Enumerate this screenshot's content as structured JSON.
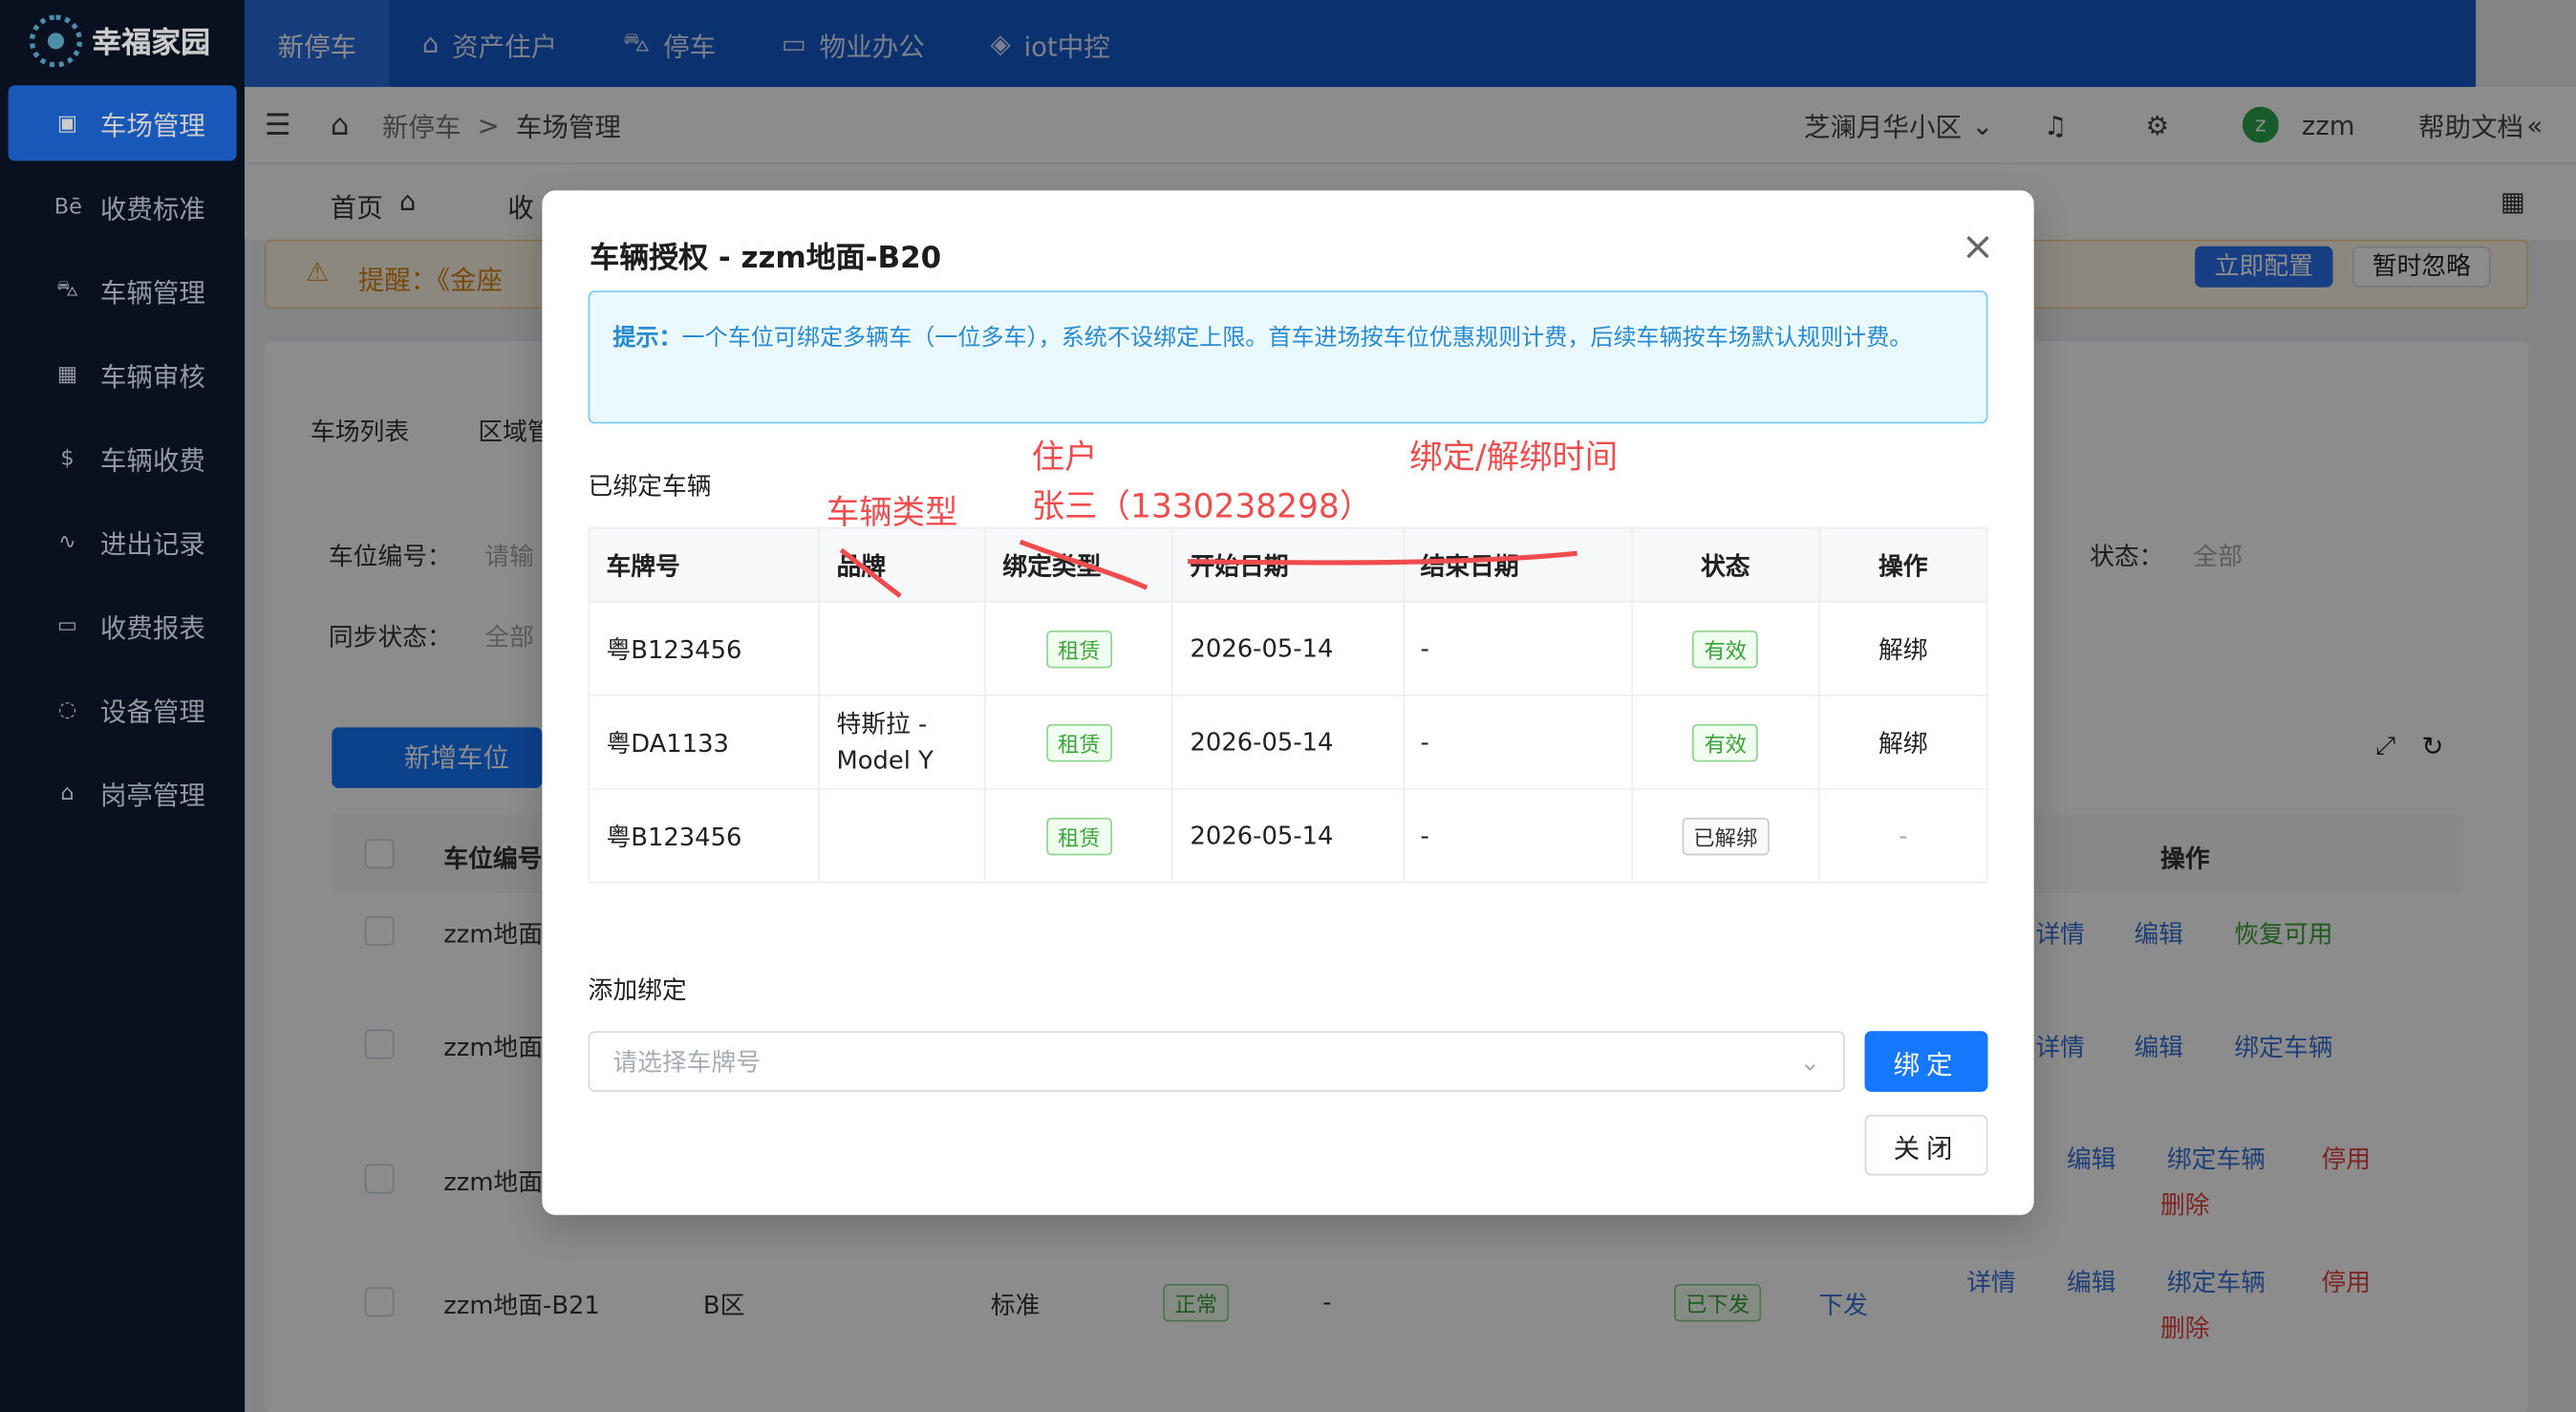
{
  "app": {
    "brand": "幸福家园"
  },
  "sidebar": {
    "items": [
      {
        "icon": "chip-icon",
        "label": "车场管理",
        "active": true
      },
      {
        "icon": "be-icon",
        "label": "收费标准"
      },
      {
        "icon": "car-icon",
        "label": "车辆管理"
      },
      {
        "icon": "building-icon",
        "label": "车辆审核"
      },
      {
        "icon": "coin-icon",
        "label": "车辆收费"
      },
      {
        "icon": "route-icon",
        "label": "进出记录"
      },
      {
        "icon": "monitor-icon",
        "label": "收费报表"
      },
      {
        "icon": "device-icon",
        "label": "设备管理"
      },
      {
        "icon": "bank-icon",
        "label": "岗亭管理"
      }
    ]
  },
  "topnav": {
    "tabs": [
      {
        "label": "新停车",
        "active": true
      },
      {
        "label": "资产住户",
        "icon": "home-icon"
      },
      {
        "label": "停车",
        "icon": "car-icon"
      },
      {
        "label": "物业办公",
        "icon": "laptop-icon"
      },
      {
        "label": "iot中控",
        "icon": "cube-icon"
      }
    ]
  },
  "header": {
    "breadcrumb": [
      "新停车",
      ">",
      "车场管理"
    ],
    "community": "芝澜月华小区",
    "user": "zzm",
    "user_initial": "z",
    "help": "帮助文档"
  },
  "page_tabs": {
    "home": "首页",
    "second": "收"
  },
  "background": {
    "reminder": "提醒：《金座",
    "config_button": "立即配置",
    "ignore_button": "暂时忽略",
    "tabs": [
      "车场列表",
      "区域管"
    ],
    "filters": {
      "space_no": "车位编号：",
      "space_placeholder": "请输",
      "sync": "同步状态：",
      "sync_value": "全部",
      "status": "状态：",
      "status_value": "全部"
    },
    "add_button": "新增车位",
    "table_header": {
      "space": "车位编号",
      "action": "操作"
    },
    "rows": [
      {
        "space": "zzm地面",
        "actions": [
          "详情",
          "编辑",
          "恢复可用"
        ]
      },
      {
        "space": "zzm地面",
        "actions": [
          "详情",
          "编辑",
          "绑定车辆"
        ]
      },
      {
        "space": "zzm地面",
        "actions": [
          "编辑",
          "绑定车辆",
          "停用",
          "删除"
        ]
      },
      {
        "space": "zzm地面-B21",
        "zone": "B区",
        "type": "标准",
        "state": "正常",
        "dash": "-",
        "issued": "已下发",
        "issue": "下发",
        "actions": [
          "详情",
          "编辑",
          "绑定车辆",
          "停用",
          "删除"
        ]
      }
    ]
  },
  "modal": {
    "title": "车辆授权 - zzm地面-B20",
    "tip_label": "提示：",
    "tip_text": "一个车位可绑定多辆车（一位多车），系统不设绑定上限。首车进场按车位优惠规则计费，后续车辆按车场默认规则计费。",
    "bound_section": "已绑定车辆",
    "columns": [
      "车牌号",
      "品牌",
      "绑定类型",
      "开始日期",
      "结束日期",
      "状态",
      "操作"
    ],
    "rows": [
      {
        "plate": "粤B123456",
        "brand": "",
        "type": "租赁",
        "start": "2026-05-14",
        "end": "-",
        "status": "有效",
        "action": "解绑"
      },
      {
        "plate": "粤DA1133",
        "brand": "特斯拉 - Model Y",
        "type": "租赁",
        "start": "2026-05-14",
        "end": "-",
        "status": "有效",
        "action": "解绑"
      },
      {
        "plate": "粤B123456",
        "brand": "",
        "type": "租赁",
        "start": "2026-05-14",
        "end": "-",
        "status": "已解绑",
        "action": "-"
      }
    ],
    "add_section": "添加绑定",
    "plate_placeholder": "请选择车牌号",
    "bind_button": "绑定",
    "close_button": "关闭"
  },
  "annotations": {
    "vehicle_type": "车辆类型",
    "resident": "住户",
    "resident_name": "张三（1330238298）",
    "bind_time": "绑定/解绑时间"
  },
  "colors": {
    "sidebar": "#0c1628",
    "topbar": "#1559c9",
    "primary": "#1677ff",
    "annotation": "#ef4d4d"
  }
}
